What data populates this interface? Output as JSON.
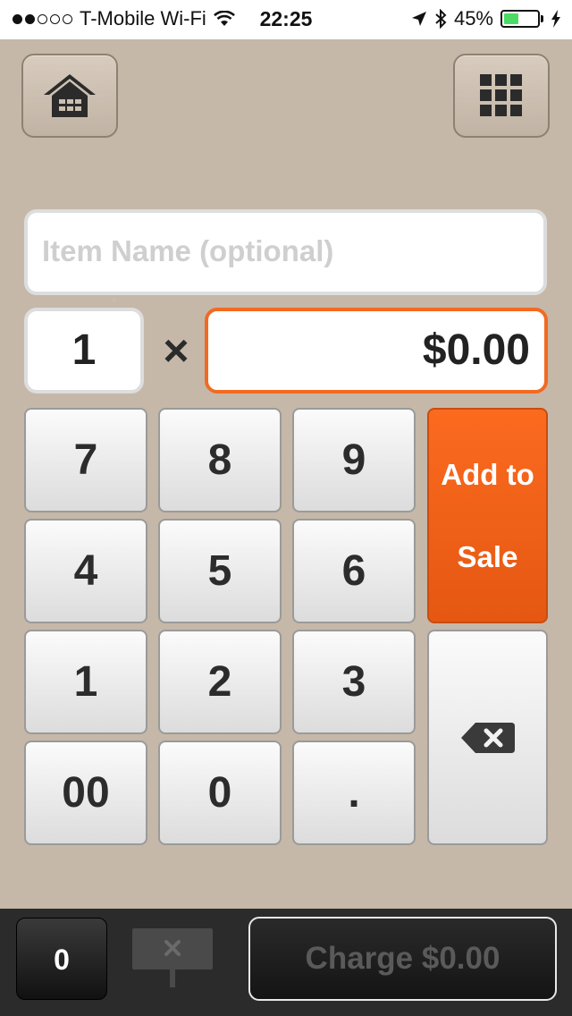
{
  "status_bar": {
    "carrier": "T-Mobile Wi-Fi",
    "time": "22:25",
    "battery_percent": "45%",
    "battery_level": 0.45,
    "signal_bars_filled": 2,
    "signal_bars_total": 5,
    "icons": [
      "wifi-icon",
      "location-arrow-icon",
      "bluetooth-icon",
      "battery-icon",
      "charging-bolt-icon"
    ]
  },
  "toolbar": {
    "home_icon": "home-icon",
    "grid_icon": "grid-icon"
  },
  "entry": {
    "item_name_placeholder": "Item Name (optional)",
    "quantity": "1",
    "times_symbol": "×",
    "price": "$0.00",
    "price_accent_color": "#f26a21"
  },
  "keypad": {
    "row1": [
      "7",
      "8",
      "9"
    ],
    "row2": [
      "4",
      "5",
      "6"
    ],
    "row3": [
      "1",
      "2",
      "3"
    ],
    "row4": [
      "00",
      "0",
      "."
    ],
    "add_to_sale_line1": "Add to",
    "add_to_sale_line2": "Sale",
    "add_to_sale_color": "#f26a21",
    "backspace_icon": "backspace-icon"
  },
  "bottom_bar": {
    "cart_count": "0",
    "clear_icon": "clear-sign-icon",
    "charge_label": "Charge $0.00"
  }
}
